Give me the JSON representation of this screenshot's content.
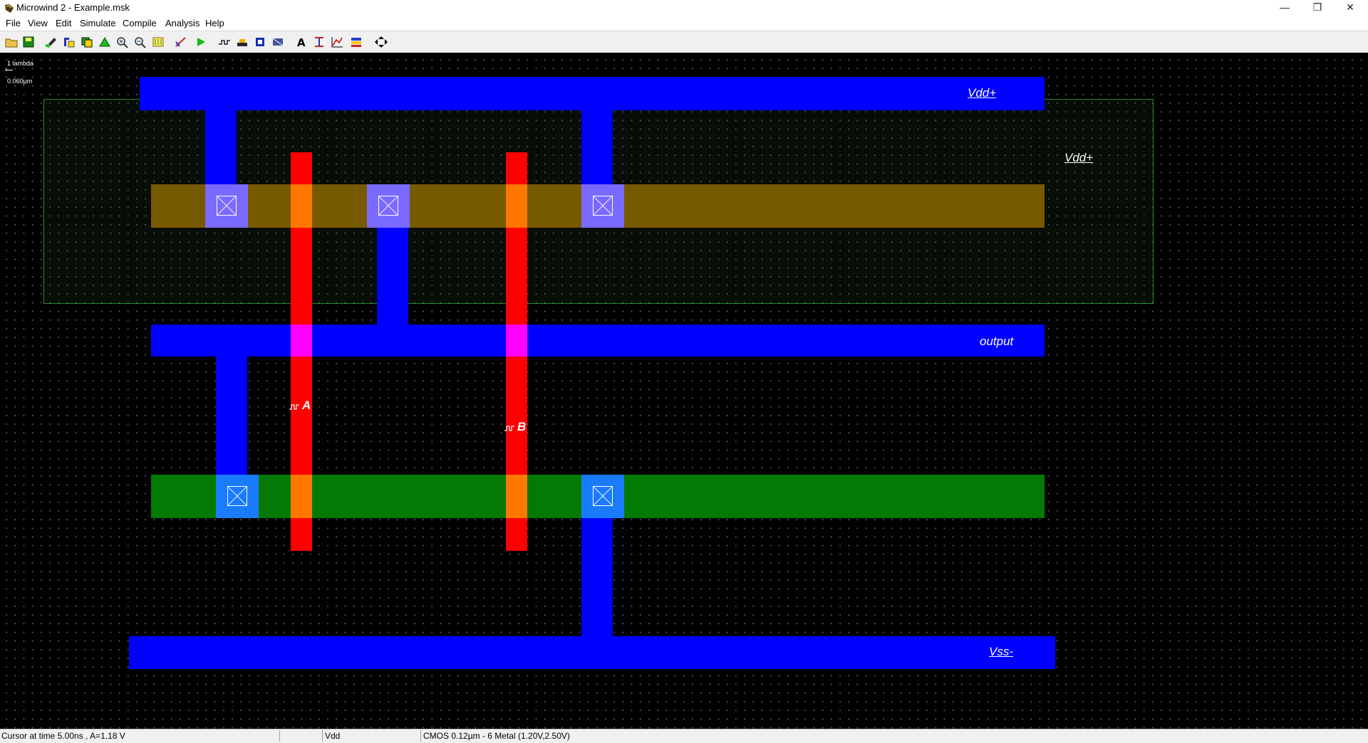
{
  "window": {
    "title": "Microwind 2 - Example.msk",
    "app_icon": "microwind-icon",
    "controls": {
      "minimize": "—",
      "maximize": "❐",
      "close": "✕"
    }
  },
  "menu": {
    "items": [
      {
        "label": "File"
      },
      {
        "label": "View"
      },
      {
        "label": "Edit"
      },
      {
        "label": "Simulate"
      },
      {
        "label": "Compile"
      },
      {
        "label": "Analysis"
      },
      {
        "label": "Help"
      }
    ]
  },
  "toolbar": {
    "icons": [
      "open-folder-icon",
      "save-icon",
      "draw-layer-icon",
      "move-copy-icon",
      "duplicate-icon",
      "stretch-icon",
      "zoom-in-icon",
      "zoom-out-icon",
      "view-all-icon",
      "measure-icon",
      "run-simulation-icon",
      "cross-section-icon",
      "process-view-icon",
      "3d-view-icon",
      "palette-icon",
      "add-text-icon",
      "cut-icon",
      "chart-icon",
      "layers-icon",
      "navigate-icon"
    ]
  },
  "canvas": {
    "scale": {
      "line1": "1 lambda",
      "line2": "0.060µm"
    },
    "colors": {
      "metal1": "#0000ff",
      "polysilicon": "#ff0000",
      "p_diffusion": "#775a00",
      "n_diffusion": "#047a04",
      "n_well_border": "#2a8a2a",
      "contact_p": "#7a6aff",
      "contact_n": "#1a7bff",
      "poly_contact": "#ff00ff",
      "background": "#000000"
    },
    "labels": {
      "vdd_rail": "Vdd+",
      "vdd_well": "Vdd+",
      "output": "output",
      "input_a": "A",
      "input_b": "B",
      "vss": "Vss-"
    }
  },
  "status": {
    "cursor": "Cursor at  time 5.00ns , A=1.18 V",
    "node": "Vdd",
    "technology": "CMOS 0.12µm - 6 Metal (1.20V,2.50V)"
  }
}
